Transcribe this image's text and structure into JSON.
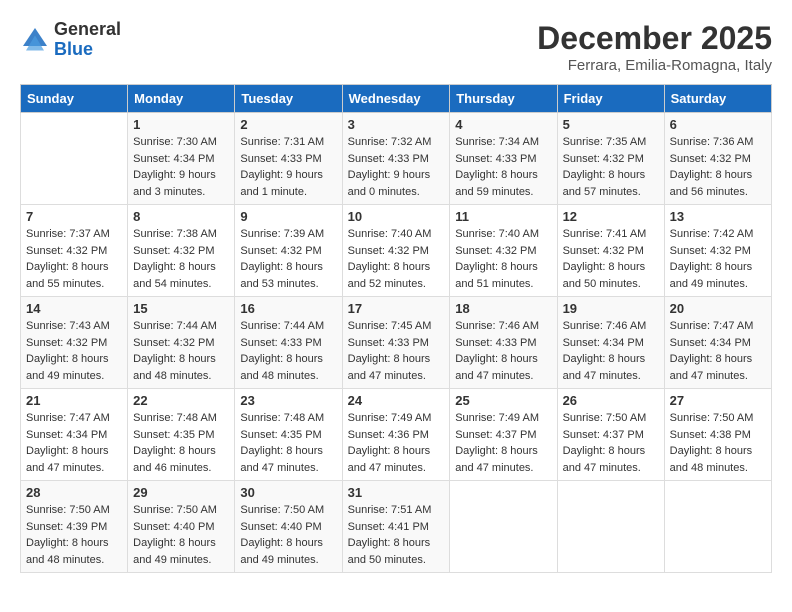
{
  "logo": {
    "general": "General",
    "blue": "Blue"
  },
  "title": "December 2025",
  "location": "Ferrara, Emilia-Romagna, Italy",
  "weekdays": [
    "Sunday",
    "Monday",
    "Tuesday",
    "Wednesday",
    "Thursday",
    "Friday",
    "Saturday"
  ],
  "weeks": [
    [
      {
        "day": "",
        "sunrise": "",
        "sunset": "",
        "daylight": ""
      },
      {
        "day": "1",
        "sunrise": "Sunrise: 7:30 AM",
        "sunset": "Sunset: 4:34 PM",
        "daylight": "Daylight: 9 hours and 3 minutes."
      },
      {
        "day": "2",
        "sunrise": "Sunrise: 7:31 AM",
        "sunset": "Sunset: 4:33 PM",
        "daylight": "Daylight: 9 hours and 1 minute."
      },
      {
        "day": "3",
        "sunrise": "Sunrise: 7:32 AM",
        "sunset": "Sunset: 4:33 PM",
        "daylight": "Daylight: 9 hours and 0 minutes."
      },
      {
        "day": "4",
        "sunrise": "Sunrise: 7:34 AM",
        "sunset": "Sunset: 4:33 PM",
        "daylight": "Daylight: 8 hours and 59 minutes."
      },
      {
        "day": "5",
        "sunrise": "Sunrise: 7:35 AM",
        "sunset": "Sunset: 4:32 PM",
        "daylight": "Daylight: 8 hours and 57 minutes."
      },
      {
        "day": "6",
        "sunrise": "Sunrise: 7:36 AM",
        "sunset": "Sunset: 4:32 PM",
        "daylight": "Daylight: 8 hours and 56 minutes."
      }
    ],
    [
      {
        "day": "7",
        "sunrise": "Sunrise: 7:37 AM",
        "sunset": "Sunset: 4:32 PM",
        "daylight": "Daylight: 8 hours and 55 minutes."
      },
      {
        "day": "8",
        "sunrise": "Sunrise: 7:38 AM",
        "sunset": "Sunset: 4:32 PM",
        "daylight": "Daylight: 8 hours and 54 minutes."
      },
      {
        "day": "9",
        "sunrise": "Sunrise: 7:39 AM",
        "sunset": "Sunset: 4:32 PM",
        "daylight": "Daylight: 8 hours and 53 minutes."
      },
      {
        "day": "10",
        "sunrise": "Sunrise: 7:40 AM",
        "sunset": "Sunset: 4:32 PM",
        "daylight": "Daylight: 8 hours and 52 minutes."
      },
      {
        "day": "11",
        "sunrise": "Sunrise: 7:40 AM",
        "sunset": "Sunset: 4:32 PM",
        "daylight": "Daylight: 8 hours and 51 minutes."
      },
      {
        "day": "12",
        "sunrise": "Sunrise: 7:41 AM",
        "sunset": "Sunset: 4:32 PM",
        "daylight": "Daylight: 8 hours and 50 minutes."
      },
      {
        "day": "13",
        "sunrise": "Sunrise: 7:42 AM",
        "sunset": "Sunset: 4:32 PM",
        "daylight": "Daylight: 8 hours and 49 minutes."
      }
    ],
    [
      {
        "day": "14",
        "sunrise": "Sunrise: 7:43 AM",
        "sunset": "Sunset: 4:32 PM",
        "daylight": "Daylight: 8 hours and 49 minutes."
      },
      {
        "day": "15",
        "sunrise": "Sunrise: 7:44 AM",
        "sunset": "Sunset: 4:32 PM",
        "daylight": "Daylight: 8 hours and 48 minutes."
      },
      {
        "day": "16",
        "sunrise": "Sunrise: 7:44 AM",
        "sunset": "Sunset: 4:33 PM",
        "daylight": "Daylight: 8 hours and 48 minutes."
      },
      {
        "day": "17",
        "sunrise": "Sunrise: 7:45 AM",
        "sunset": "Sunset: 4:33 PM",
        "daylight": "Daylight: 8 hours and 47 minutes."
      },
      {
        "day": "18",
        "sunrise": "Sunrise: 7:46 AM",
        "sunset": "Sunset: 4:33 PM",
        "daylight": "Daylight: 8 hours and 47 minutes."
      },
      {
        "day": "19",
        "sunrise": "Sunrise: 7:46 AM",
        "sunset": "Sunset: 4:34 PM",
        "daylight": "Daylight: 8 hours and 47 minutes."
      },
      {
        "day": "20",
        "sunrise": "Sunrise: 7:47 AM",
        "sunset": "Sunset: 4:34 PM",
        "daylight": "Daylight: 8 hours and 47 minutes."
      }
    ],
    [
      {
        "day": "21",
        "sunrise": "Sunrise: 7:47 AM",
        "sunset": "Sunset: 4:34 PM",
        "daylight": "Daylight: 8 hours and 47 minutes."
      },
      {
        "day": "22",
        "sunrise": "Sunrise: 7:48 AM",
        "sunset": "Sunset: 4:35 PM",
        "daylight": "Daylight: 8 hours and 46 minutes."
      },
      {
        "day": "23",
        "sunrise": "Sunrise: 7:48 AM",
        "sunset": "Sunset: 4:35 PM",
        "daylight": "Daylight: 8 hours and 47 minutes."
      },
      {
        "day": "24",
        "sunrise": "Sunrise: 7:49 AM",
        "sunset": "Sunset: 4:36 PM",
        "daylight": "Daylight: 8 hours and 47 minutes."
      },
      {
        "day": "25",
        "sunrise": "Sunrise: 7:49 AM",
        "sunset": "Sunset: 4:37 PM",
        "daylight": "Daylight: 8 hours and 47 minutes."
      },
      {
        "day": "26",
        "sunrise": "Sunrise: 7:50 AM",
        "sunset": "Sunset: 4:37 PM",
        "daylight": "Daylight: 8 hours and 47 minutes."
      },
      {
        "day": "27",
        "sunrise": "Sunrise: 7:50 AM",
        "sunset": "Sunset: 4:38 PM",
        "daylight": "Daylight: 8 hours and 48 minutes."
      }
    ],
    [
      {
        "day": "28",
        "sunrise": "Sunrise: 7:50 AM",
        "sunset": "Sunset: 4:39 PM",
        "daylight": "Daylight: 8 hours and 48 minutes."
      },
      {
        "day": "29",
        "sunrise": "Sunrise: 7:50 AM",
        "sunset": "Sunset: 4:40 PM",
        "daylight": "Daylight: 8 hours and 49 minutes."
      },
      {
        "day": "30",
        "sunrise": "Sunrise: 7:50 AM",
        "sunset": "Sunset: 4:40 PM",
        "daylight": "Daylight: 8 hours and 49 minutes."
      },
      {
        "day": "31",
        "sunrise": "Sunrise: 7:51 AM",
        "sunset": "Sunset: 4:41 PM",
        "daylight": "Daylight: 8 hours and 50 minutes."
      },
      {
        "day": "",
        "sunrise": "",
        "sunset": "",
        "daylight": ""
      },
      {
        "day": "",
        "sunrise": "",
        "sunset": "",
        "daylight": ""
      },
      {
        "day": "",
        "sunrise": "",
        "sunset": "",
        "daylight": ""
      }
    ]
  ]
}
